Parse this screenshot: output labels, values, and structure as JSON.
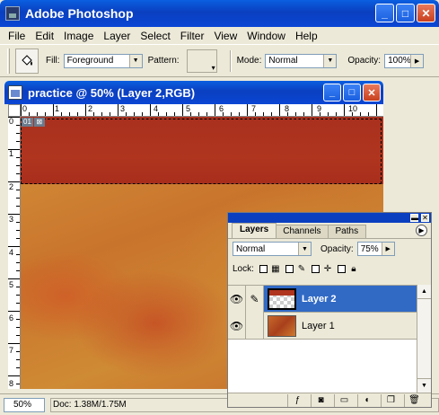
{
  "app": {
    "title": "Adobe Photoshop"
  },
  "window_buttons": {
    "minimize": "_",
    "maximize": "□",
    "close": "✕"
  },
  "menu": [
    "File",
    "Edit",
    "Image",
    "Layer",
    "Select",
    "Filter",
    "View",
    "Window",
    "Help"
  ],
  "options_bar": {
    "tool_icon": "paint-bucket-icon",
    "fill_label": "Fill:",
    "fill_value": "Foreground",
    "pattern_label": "Pattern:",
    "mode_label": "Mode:",
    "mode_value": "Normal",
    "opacity_label": "Opacity:",
    "opacity_value": "100%"
  },
  "document": {
    "title": "practice @ 50% (Layer 2,RGB)",
    "ruler_h": [
      "0",
      "1",
      "2",
      "3",
      "4",
      "5",
      "6",
      "7",
      "8",
      "9",
      "10"
    ],
    "ruler_v": [
      "0",
      "1",
      "2",
      "3",
      "4",
      "5",
      "6",
      "7",
      "8"
    ],
    "slice_number": "01",
    "colors": {
      "top_band": "#b0351f",
      "canvas": "#cf8a34"
    }
  },
  "status": {
    "zoom": "50%",
    "doc_info": "Doc: 1.38M/1.75M"
  },
  "layers_palette": {
    "tabs": [
      "Layers",
      "Channels",
      "Paths"
    ],
    "active_tab": "Layers",
    "blend_mode": "Normal",
    "opacity_label": "Opacity:",
    "opacity_value": "75%",
    "lock_label": "Lock:",
    "layers": [
      {
        "name": "Layer 2",
        "selected": true
      },
      {
        "name": "Layer 1",
        "selected": false
      }
    ]
  }
}
